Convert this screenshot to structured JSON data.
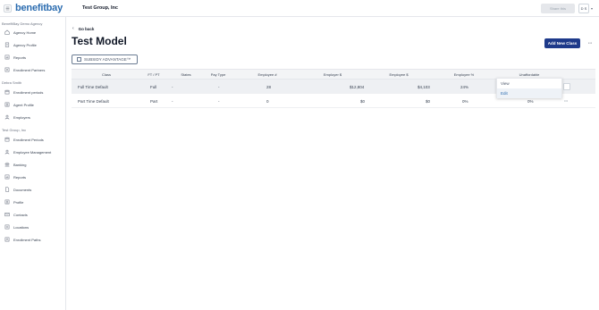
{
  "topbar": {
    "brand": "benefitbay",
    "company": "Test Group, Inc",
    "share_label": "Share this",
    "avatar": "D S"
  },
  "sidebar": {
    "groups": [
      {
        "heading": "BenefitBay Demo Agency",
        "items": [
          {
            "label": "Agency Home",
            "icon": "home-icon"
          },
          {
            "label": "Agency Profile",
            "icon": "building-icon"
          },
          {
            "label": "Reports",
            "icon": "report-icon"
          },
          {
            "label": "Enrollment Partners",
            "icon": "partners-icon"
          }
        ]
      },
      {
        "heading": "Debra Smith",
        "items": [
          {
            "label": "Enrollment periods",
            "icon": "calendar-icon"
          },
          {
            "label": "Agent Profile",
            "icon": "profile-icon"
          },
          {
            "label": "Employers",
            "icon": "users-icon"
          }
        ]
      },
      {
        "heading": "Test Group, Inc",
        "items": [
          {
            "label": "Enrollment Periods",
            "icon": "calendar-icon"
          },
          {
            "label": "Employee Management",
            "icon": "users-icon"
          },
          {
            "label": "Banking",
            "icon": "bank-icon"
          },
          {
            "label": "Reports",
            "icon": "report-icon"
          },
          {
            "label": "Documents",
            "icon": "document-icon"
          },
          {
            "label": "Profile",
            "icon": "profile-icon"
          },
          {
            "label": "Contacts",
            "icon": "mail-icon"
          },
          {
            "label": "Locations",
            "icon": "location-icon"
          },
          {
            "label": "Enrollment Paths",
            "icon": "path-icon"
          }
        ]
      }
    ]
  },
  "main": {
    "go_back": "Go back",
    "title": "Test Model",
    "add_class": "Add New Class",
    "more": "···",
    "subsidy_label": "SUBSIDY ADVANTAGE™"
  },
  "table": {
    "headers": [
      "Class",
      "FT / PT",
      "States",
      "Pay Type",
      "Employee #",
      "Employer $",
      "Employee $",
      "Employee %",
      "Unaffordable"
    ],
    "rows": [
      {
        "class": "Full Time Default",
        "ftpt": "Full",
        "states": "-",
        "pay": "-",
        "emp_num": "28",
        "employer": "$12,804",
        "employee": "$4,103",
        "pct": "24%",
        "unaff": "0%"
      },
      {
        "class": "Part Time Default",
        "ftpt": "Part",
        "states": "-",
        "pay": "-",
        "emp_num": "0",
        "employer": "$0",
        "employee": "$0",
        "pct": "0%",
        "unaff": "0%"
      }
    ]
  },
  "menu": {
    "items": [
      "View",
      "Edit"
    ]
  },
  "colors": {
    "primary": "#1e3a8a",
    "brand": "#2b6cb0",
    "row_highlight": "#eef0f3"
  }
}
